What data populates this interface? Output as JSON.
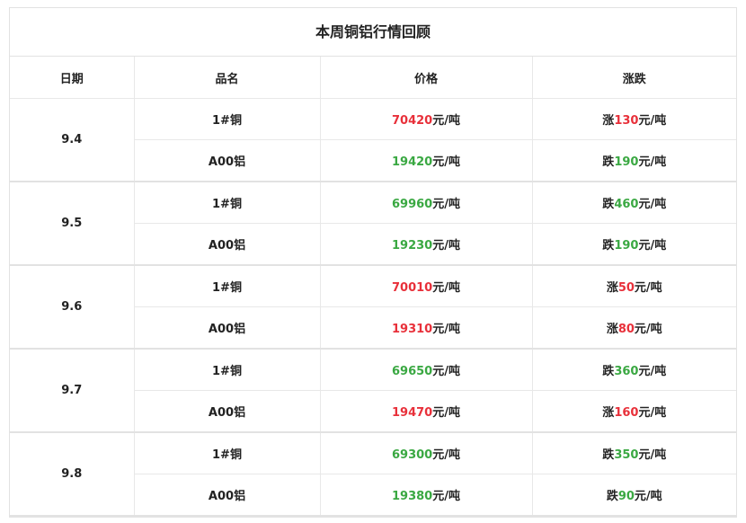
{
  "title": "本周铜铝行情回顾",
  "headers": [
    "日期",
    "品名",
    "价格",
    "涨跌"
  ],
  "colors": {
    "up": "#e8303a",
    "down": "#3aa842"
  },
  "unit": "元/吨",
  "groups": [
    {
      "date": "9.4",
      "rows": [
        {
          "name": "1#铜",
          "price": "70420",
          "price_dir": "up",
          "change_word": "涨",
          "change": "130",
          "change_dir": "up"
        },
        {
          "name": "A00铝",
          "price": "19420",
          "price_dir": "down",
          "change_word": "跌",
          "change": "190",
          "change_dir": "down"
        }
      ]
    },
    {
      "date": "9.5",
      "rows": [
        {
          "name": "1#铜",
          "price": "69960",
          "price_dir": "down",
          "change_word": "跌",
          "change": "460",
          "change_dir": "down"
        },
        {
          "name": "A00铝",
          "price": "19230",
          "price_dir": "down",
          "change_word": "跌",
          "change": "190",
          "change_dir": "down"
        }
      ]
    },
    {
      "date": "9.6",
      "rows": [
        {
          "name": "1#铜",
          "price": "70010",
          "price_dir": "up",
          "change_word": "涨",
          "change": "50",
          "change_dir": "up"
        },
        {
          "name": "A00铝",
          "price": "19310",
          "price_dir": "up",
          "change_word": "涨",
          "change": "80",
          "change_dir": "up"
        }
      ]
    },
    {
      "date": "9.7",
      "rows": [
        {
          "name": "1#铜",
          "price": "69650",
          "price_dir": "down",
          "change_word": "跌",
          "change": "360",
          "change_dir": "down"
        },
        {
          "name": "A00铝",
          "price": "19470",
          "price_dir": "up",
          "change_word": "涨",
          "change": "160",
          "change_dir": "up"
        }
      ]
    },
    {
      "date": "9.8",
      "rows": [
        {
          "name": "1#铜",
          "price": "69300",
          "price_dir": "down",
          "change_word": "跌",
          "change": "350",
          "change_dir": "down"
        },
        {
          "name": "A00铝",
          "price": "19380",
          "price_dir": "down",
          "change_word": "跌",
          "change": "90",
          "change_dir": "down"
        }
      ]
    }
  ]
}
